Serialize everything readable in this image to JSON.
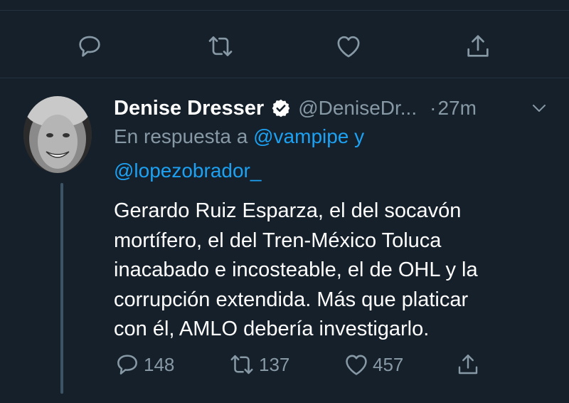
{
  "top_actions": {
    "reply_icon": "reply-icon",
    "retweet_icon": "retweet-icon",
    "like_icon": "heart-icon",
    "share_icon": "share-icon"
  },
  "tweet": {
    "author_name": "Denise Dresser",
    "handle": "@DeniseDr...",
    "separator": "·",
    "time": "27m",
    "reply_prefix": "En respuesta a",
    "mention_1": "@vampipe",
    "connector": "y",
    "mention_2": "@lopezobrador_",
    "text_lines": [
      "Gerardo Ruiz Esparza, el del socavón",
      "mortífero, el del Tren-México Toluca",
      "inacabado e incosteable, el de OHL y la",
      "corrupción extendida. Más que platicar",
      "con él, AMLO debería investigarlo."
    ],
    "replies": "148",
    "retweets": "137",
    "likes": "457"
  },
  "colors": {
    "background": "#15202b",
    "secondary_text": "#8899a6",
    "link": "#1da1f2",
    "divider": "#253341",
    "thread_line": "#3d5466"
  }
}
